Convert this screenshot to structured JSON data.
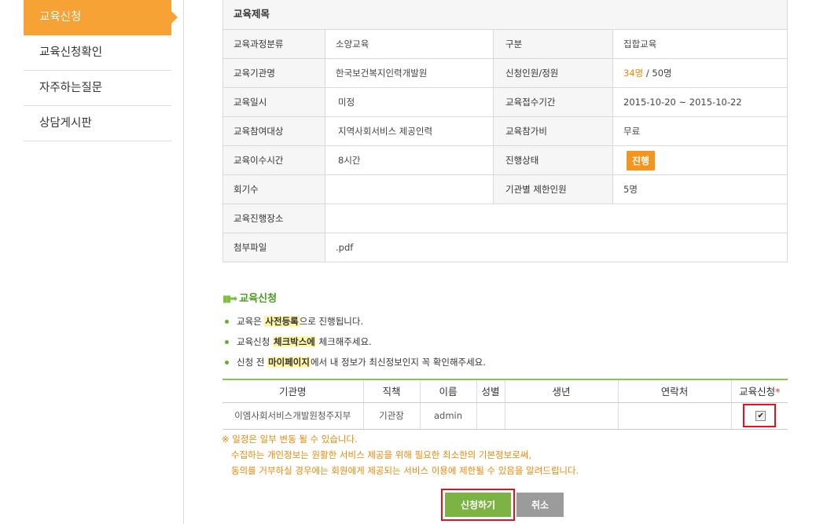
{
  "sidebar": {
    "items": [
      {
        "label": "교육신청",
        "active": true
      },
      {
        "label": "교육신청확인"
      },
      {
        "label": "자주하는질문"
      },
      {
        "label": "상담게시판"
      }
    ]
  },
  "info": {
    "title": "교육제목",
    "rows": [
      {
        "l1": "교육과정분류",
        "v1": "소양교육",
        "l2": "구분",
        "v2": "집합교육"
      },
      {
        "l1": "교육기관명",
        "v1": "한국보건복지인력개발원",
        "l2": "신청인원/정원",
        "v2_applied": "34명",
        "v2_sep": " / ",
        "v2_capacity": "50명"
      },
      {
        "l1": "교육일시",
        "v1": "미정",
        "l2": "교육접수기간",
        "v2": "2015-10-20 ~ 2015-10-22"
      },
      {
        "l1": "교육참여대상",
        "v1": "지역사회서비스 제공인력",
        "l2": "교육참가비",
        "v2": "무료"
      },
      {
        "l1": "교육이수시간",
        "v1": "8시간",
        "l2": "진행상태",
        "v2": "진행"
      },
      {
        "l1": "회기수",
        "v1": "",
        "l2": "기관별 제한인원",
        "v2": "5명"
      },
      {
        "l1": "교육진행장소",
        "v1": ""
      },
      {
        "l1": "첨부파일",
        "v1": ".pdf"
      }
    ]
  },
  "apply_section": {
    "title": "교육신청",
    "bullets": [
      {
        "pre": "교육은 ",
        "hl": "사전등록",
        "post": "으로 진행됩니다."
      },
      {
        "pre": "교육신청 ",
        "hl": "체크박스에",
        "post": " 체크해주세요."
      },
      {
        "pre": "신청 전 ",
        "hl": "마이페이지",
        "post": "에서 내 정보가 최신정보인지 꼭 확인해주세요."
      }
    ]
  },
  "applicant_table": {
    "headers": [
      "기관명",
      "직책",
      "이름",
      "성별",
      "생년",
      "연락처",
      "교육신청"
    ],
    "required_mark": "*",
    "row": {
      "org": "이엠사회서비스개발원청주지부",
      "position": "기관장",
      "name": "admin",
      "gender": "",
      "birth": "",
      "contact": "",
      "checked": true
    }
  },
  "notice": {
    "line1": "※ 일정은 일부 변동 될 수 있습니다.",
    "line2": "수집하는 개인정보는 원활한 서비스 제공을 위해 필요한 최소한의 기본정보로써,",
    "line3": "동의를 거부하실 경우에는 회원에게 제공되는 서비스 이용에 제한될 수 있음을 알려드립니다."
  },
  "buttons": {
    "apply": "신청하기",
    "cancel": "취소"
  },
  "colors": {
    "accent": "#f7a234",
    "green": "#7cb342",
    "highlight_red": "#e0141e"
  }
}
